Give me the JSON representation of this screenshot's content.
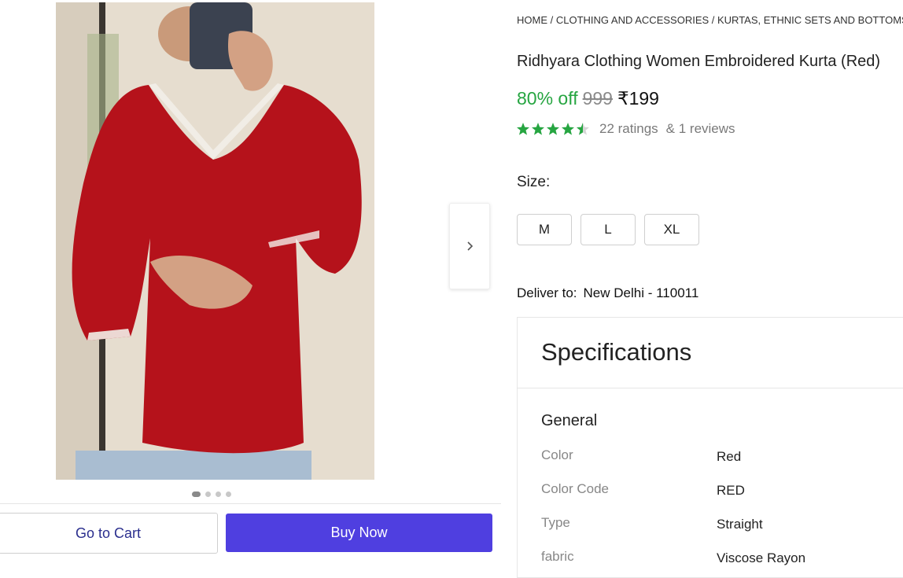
{
  "breadcrumb": "HOME / CLOTHING AND ACCESSORIES / KURTAS, ETHNIC SETS AND BOTTOMS /",
  "product": {
    "title": "Ridhyara Clothing Women Embroidered Kurta (Red)",
    "discount": "80% off",
    "mrp": "999",
    "price": "₹199",
    "rating_value": 4.5,
    "ratings": "22 ratings",
    "reviews": "& 1 reviews"
  },
  "size": {
    "label": "Size:",
    "options": [
      "M",
      "L",
      "XL"
    ]
  },
  "delivery": {
    "label": "Deliver to:",
    "location": "New Delhi - 110011"
  },
  "specs": {
    "title": "Specifications",
    "group": "General",
    "rows": [
      {
        "label": "Color",
        "value": "Red"
      },
      {
        "label": "Color Code",
        "value": "RED"
      },
      {
        "label": "Type",
        "value": "Straight"
      },
      {
        "label": "fabric",
        "value": "Viscose Rayon"
      }
    ]
  },
  "actions": {
    "cart": "Go to Cart",
    "buy": "Buy Now"
  },
  "carousel": {
    "count": 4,
    "active": 1
  },
  "icons": {
    "next": "chevron-right-icon",
    "star": "star-icon"
  },
  "colors": {
    "accent": "#4f3fe0",
    "discount": "#26a541",
    "rating": "#26a541",
    "link": "#2b2f8e"
  }
}
